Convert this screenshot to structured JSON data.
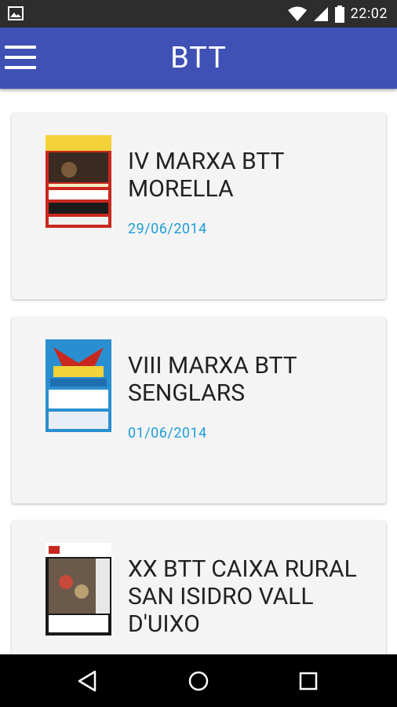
{
  "status": {
    "time": "22:02"
  },
  "appbar": {
    "title": "BTT"
  },
  "events": [
    {
      "title": "IV MARXA BTT MORELLA",
      "date": "29/06/2014"
    },
    {
      "title": "VIII MARXA BTT SENGLARS",
      "date": "01/06/2014"
    },
    {
      "title": "XX BTT CAIXA RURAL SAN ISIDRO VALL D'UIXO",
      "date": ""
    }
  ],
  "colors": {
    "primary": "#3f51b5",
    "date": "#1e9dd8",
    "card": "#f4f4f4"
  },
  "icons": {
    "status_left": "image-notification-icon",
    "status_right": [
      "wifi-icon",
      "cell-signal-icon",
      "battery-icon"
    ],
    "nav": [
      "back-icon",
      "home-icon",
      "recents-icon"
    ]
  }
}
